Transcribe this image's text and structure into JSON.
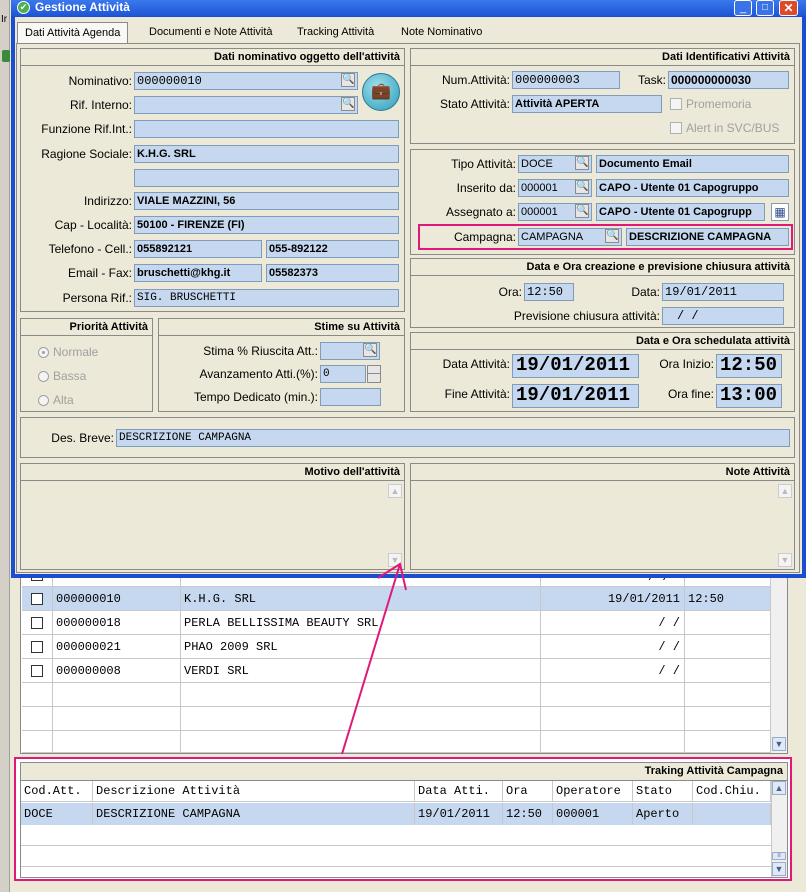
{
  "window": {
    "title": "Gestione Attività"
  },
  "background_fragments": {
    "left_top": "Ir"
  },
  "tabs": [
    "Dati Attività Agenda",
    "Documenti e Note Attività",
    "Tracking Attività",
    "Note Nominativo"
  ],
  "nominativo_panel": {
    "title": "Dati nominativo oggetto dell'attività",
    "labels": {
      "nominativo": "Nominativo:",
      "rif_interno": "Rif. Interno:",
      "funzione": "Funzione Rif.Int.:",
      "ragione": "Ragione Sociale:",
      "indirizzo": "Indirizzo:",
      "cap": "Cap - Località:",
      "telefono": "Telefono - Cell.:",
      "email": "Email - Fax:",
      "persona": "Persona Rif.:"
    },
    "values": {
      "nominativo": "000000010",
      "rif_interno": "",
      "funzione": "",
      "ragione": "K.H.G. SRL",
      "ragione2": "",
      "indirizzo": "VIALE MAZZINI, 56",
      "cap": "50100 - FIRENZE (FI)",
      "telefono": "055892121",
      "cellulare": "055-892122",
      "email": "bruschetti@khg.it",
      "fax": "05582373",
      "persona": "SIG. BRUSCHETTI"
    }
  },
  "identificativi_panel": {
    "title": "Dati Identificativi Attività",
    "labels": {
      "num": "Num.Attività:",
      "task": "Task:",
      "stato": "Stato Attività:",
      "promemoria": "Promemoria",
      "alert": "Alert in SVC/BUS"
    },
    "values": {
      "num": "000000003",
      "task": "000000000030",
      "stato": "Attività APERTA"
    }
  },
  "tipo_panel": {
    "labels": {
      "tipo": "Tipo Attività:",
      "inserito": "Inserito da:",
      "assegnato": "Assegnato a:",
      "campagna": "Campagna:"
    },
    "values": {
      "tipo_code": "DOCE",
      "tipo_desc": "Documento Email",
      "inserito_code": "000001",
      "inserito_desc": "CAPO - Utente 01 Capogruppo",
      "assegnato_code": "000001",
      "assegnato_desc": "CAPO - Utente 01 Capogrupp",
      "campagna_code": "CAMPAGNA",
      "campagna_desc": "DESCRIZIONE CAMPAGNA"
    }
  },
  "creazione_panel": {
    "title": "Data e Ora creazione e previsione chiusura attività",
    "labels": {
      "ora": "Ora:",
      "data": "Data:",
      "previsione": "Previsione chiusura attività:"
    },
    "values": {
      "ora": "12:50",
      "data": "19/01/2011",
      "previsione": "  /  /"
    }
  },
  "schedulata_panel": {
    "title": "Data e Ora schedulata attività",
    "labels": {
      "data": "Data Attività:",
      "ora_inizio": "Ora Inizio:",
      "fine": "Fine Attività:",
      "ora_fine": "Ora fine:"
    },
    "values": {
      "data": "19/01/2011",
      "ora_inizio": "12:50",
      "fine": "19/01/2011",
      "ora_fine": "13:00"
    }
  },
  "priorita_panel": {
    "title": "Priorità Attività",
    "options": [
      "Normale",
      "Bassa",
      "Alta"
    ],
    "selected": "Normale"
  },
  "stime_panel": {
    "title": "Stime su Attività",
    "labels": {
      "stima": "Stima % Riuscita Att.:",
      "avanzamento": "Avanzamento Atti.(%):",
      "tempo": "Tempo Dedicato (min.):"
    },
    "values": {
      "stima": "",
      "avanzamento": "0",
      "tempo": ""
    }
  },
  "des_breve": {
    "label": "Des. Breve:",
    "value": "DESCRIZIONE CAMPAGNA"
  },
  "motivo_panel": {
    "title": "Motivo dell'attività"
  },
  "note_panel": {
    "title": "Note Attività"
  },
  "background_list": {
    "rows": [
      {
        "code": "000000010",
        "name": "K.H.G. SRL",
        "date": "19/01/2011",
        "time": "12:50"
      },
      {
        "code": "000000018",
        "name": "PERLA BELLISSIMA BEAUTY SRL",
        "date": "  /  /",
        "time": ""
      },
      {
        "code": "000000021",
        "name": "PHAO 2009 SRL",
        "date": "  /  /",
        "time": ""
      },
      {
        "code": "000000008",
        "name": "VERDI SRL",
        "date": "  /  /",
        "time": ""
      }
    ],
    "partial_row_date": "/  /"
  },
  "tracking_panel": {
    "title": "Traking Attività Campagna",
    "columns": [
      "Cod.Att.",
      "Descrizione Attività",
      "Data Atti.",
      "Ora",
      "Operatore",
      "Stato",
      "Cod.Chiu."
    ],
    "rows": [
      [
        "DOCE",
        "DESCRIZIONE CAMPAGNA",
        "19/01/2011",
        "12:50",
        "000001",
        "Aperto",
        ""
      ]
    ]
  },
  "colors": {
    "highlight": "#e0187a",
    "title_bar": "#1f55d6",
    "field": "#c6d8ef",
    "selected_row": "#c6d8ef"
  }
}
